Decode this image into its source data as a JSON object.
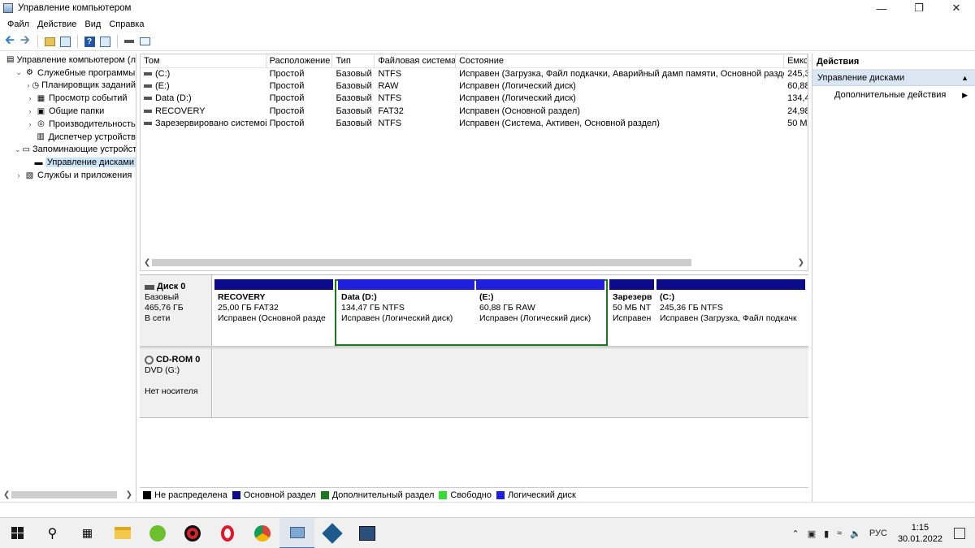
{
  "window": {
    "title": "Управление компьютером",
    "min": "—",
    "max": "❐",
    "close": "✕"
  },
  "menu": [
    "Файл",
    "Действие",
    "Вид",
    "Справка"
  ],
  "tree": {
    "items": [
      {
        "label": "Управление компьютером (л",
        "exp": "",
        "icon": "computer-management-icon",
        "indent": 0
      },
      {
        "label": "Служебные программы",
        "exp": "⌄",
        "icon": "tools-icon",
        "indent": 1
      },
      {
        "label": "Планировщик заданий",
        "exp": "›",
        "icon": "clock-icon",
        "indent": 2
      },
      {
        "label": "Просмотр событий",
        "exp": "›",
        "icon": "event-viewer-icon",
        "indent": 2
      },
      {
        "label": "Общие папки",
        "exp": "›",
        "icon": "shared-folder-icon",
        "indent": 2
      },
      {
        "label": "Производительность",
        "exp": "›",
        "icon": "performance-icon",
        "indent": 2
      },
      {
        "label": "Диспетчер устройств",
        "exp": "",
        "icon": "device-manager-icon",
        "indent": 2
      },
      {
        "label": "Запоминающие устройст",
        "exp": "⌄",
        "icon": "storage-icon",
        "indent": 1
      },
      {
        "label": "Управление дисками",
        "exp": "",
        "icon": "disk-management-icon",
        "indent": 2,
        "selected": true
      },
      {
        "label": "Службы и приложения",
        "exp": "›",
        "icon": "services-icon",
        "indent": 1
      }
    ]
  },
  "volumes": {
    "headers": [
      "Том",
      "Расположение",
      "Тип",
      "Файловая система",
      "Состояние",
      "Емкс"
    ],
    "rows": [
      [
        "(C:)",
        "Простой",
        "Базовый",
        "NTFS",
        "Исправен (Загрузка, Файл подкачки, Аварийный дамп памяти, Основной раздел)",
        "245,3"
      ],
      [
        "(E:)",
        "Простой",
        "Базовый",
        "RAW",
        "Исправен (Логический диск)",
        "60,88"
      ],
      [
        "Data (D:)",
        "Простой",
        "Базовый",
        "NTFS",
        "Исправен (Логический диск)",
        "134,4"
      ],
      [
        "RECOVERY",
        "Простой",
        "Базовый",
        "FAT32",
        "Исправен (Основной раздел)",
        "24,98"
      ],
      [
        "Зарезервировано системой",
        "Простой",
        "Базовый",
        "NTFS",
        "Исправен (Система, Активен, Основной раздел)",
        "50 M"
      ]
    ]
  },
  "disks": {
    "disk0": {
      "name": "Диск 0",
      "type": "Базовый",
      "size": "465,76 ГБ",
      "status": "В сети",
      "partitions": [
        {
          "name": "RECOVERY",
          "size": "25,00 ГБ FAT32",
          "state": "Исправен (Основной разде"
        },
        {
          "name": "Data  (D:)",
          "size": "134,47 ГБ NTFS",
          "state": "Исправен (Логический диск)"
        },
        {
          "name": "(E:)",
          "size": "60,88 ГБ RAW",
          "state": "Исправен (Логический диск)"
        },
        {
          "name": "Зарезерв",
          "size": "50 МБ NT",
          "state": "Исправен"
        },
        {
          "name": "(C:)",
          "size": "245,36 ГБ NTFS",
          "state": "Исправен (Загрузка, Файл подкачк"
        }
      ]
    },
    "cdrom0": {
      "name": "CD-ROM 0",
      "drive": "DVD (G:)",
      "media": "Нет носителя"
    }
  },
  "legend": [
    {
      "label": "Не распределена",
      "color": "#000000"
    },
    {
      "label": "Основной раздел",
      "color": "#0c0c8a"
    },
    {
      "label": "Дополнительный раздел",
      "color": "#1b7a1b"
    },
    {
      "label": "Свободно",
      "color": "#33dd33"
    },
    {
      "label": "Логический диск",
      "color": "#1f1fdd"
    }
  ],
  "actions": {
    "title": "Действия",
    "group": "Управление дисками",
    "item": "Дополнительные действия"
  },
  "taskbar": {
    "lang": "РУС",
    "time": "1:15",
    "date": "30.01.2022"
  }
}
